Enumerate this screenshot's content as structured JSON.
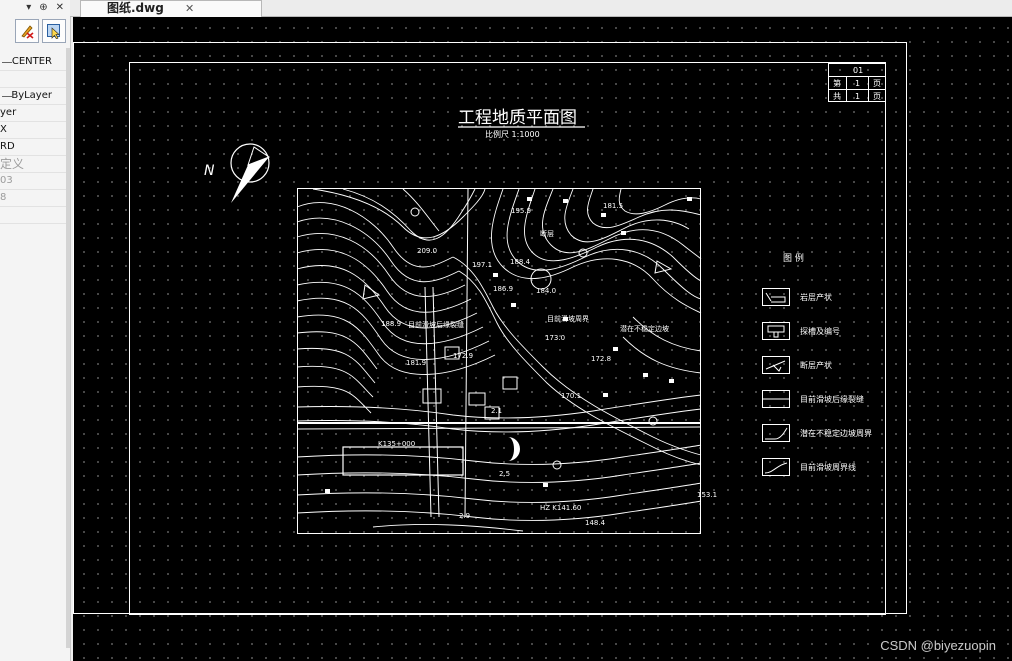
{
  "left_panel": {
    "controls": [
      "▾",
      "⊕",
      "✕"
    ],
    "properties": [
      {
        "value": "CENTER",
        "style": "dash"
      },
      {
        "value": "",
        "style": ""
      },
      {
        "value": "ByLayer",
        "style": "dash"
      },
      {
        "value": "yer",
        "style": "left"
      },
      {
        "value": "X",
        "style": "left"
      },
      {
        "value": "RD",
        "style": "left"
      },
      {
        "value": "定义",
        "style": "left gray big"
      },
      {
        "value": "03",
        "style": "left gray"
      },
      {
        "value": "8",
        "style": "left gray"
      },
      {
        "value": "",
        "style": ""
      }
    ]
  },
  "tab": {
    "label": "图纸.dwg",
    "close": "✕"
  },
  "drawing": {
    "title": "工程地质平面图",
    "scale": "比例尺  1:1000",
    "north": "N",
    "sheet_table": {
      "no": "01",
      "row1": [
        "第",
        "1",
        "页"
      ],
      "row2": [
        "共",
        "1",
        "页"
      ]
    },
    "legend_title": "图  例",
    "legend": [
      "岩层产状",
      "探槽及编号",
      "断层产状",
      "目前滑坡后缘裂缝",
      "潜在不稳定边坡周界",
      "目前滑坡周界线"
    ],
    "map_labels": [
      {
        "text": "181.5"
      },
      {
        "text": "195.9"
      },
      {
        "text": "断层"
      },
      {
        "text": "209.0"
      },
      {
        "text": "197.1"
      },
      {
        "text": "188.4"
      },
      {
        "text": "186.9"
      },
      {
        "text": "184.0"
      },
      {
        "text": "188.9"
      },
      {
        "text": "目前滑坡后缘裂缝"
      },
      {
        "text": "目前滑坡周界"
      },
      {
        "text": "173.0"
      },
      {
        "text": "潜在不稳定边坡"
      },
      {
        "text": "181.9"
      },
      {
        "text": "172.9"
      },
      {
        "text": "172.8"
      },
      {
        "text": "170.1"
      },
      {
        "text": "2.1"
      },
      {
        "text": "K135+000"
      },
      {
        "text": "2.5"
      },
      {
        "text": "153.1"
      },
      {
        "text": "2.9"
      },
      {
        "text": "HZ K141.60"
      },
      {
        "text": "148.4"
      }
    ]
  },
  "watermark": "CSDN @biyezuopin"
}
